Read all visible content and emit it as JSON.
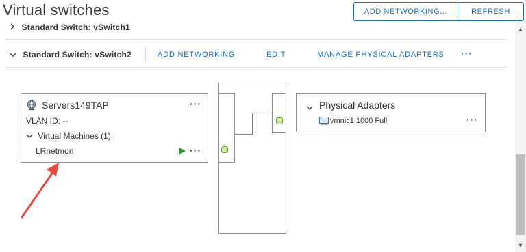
{
  "header": {
    "title": "Virtual switches"
  },
  "toolbar": {
    "add_networking_label": "ADD NETWORKING...",
    "refresh_label": "REFRESH"
  },
  "switches": [
    {
      "label": "Standard Switch: vSwitch1",
      "expanded": false
    },
    {
      "label": "Standard Switch: vSwitch2",
      "expanded": true,
      "actions": {
        "add_networking": "ADD NETWORKING",
        "edit": "EDIT",
        "manage_adapters": "MANAGE PHYSICAL ADAPTERS",
        "more": "···"
      }
    }
  ],
  "port_group": {
    "name": "Servers149TAP",
    "vlan": "VLAN ID: --",
    "vm_section": "Virtual Machines (1)",
    "vms": [
      {
        "name": "LRnetmon",
        "powered_on": true
      }
    ],
    "more": "···"
  },
  "physical_adapters": {
    "title": "Physical Adapters",
    "items": [
      {
        "label": "vmnic1 1000 Full"
      }
    ],
    "more": "···"
  },
  "icons": {
    "chevron_right": "›",
    "chevron_down": "⌄",
    "port_group_icon": "network-globe-icon",
    "nic_icon": "nic-icon",
    "play_icon": "play-icon"
  },
  "colors": {
    "accent": "#1f6fb6",
    "connector_fill": "#cfeaa5",
    "connector_border": "#6aa120",
    "annotation_arrow": "#e8473c",
    "power_on": "#2a9d2a"
  }
}
